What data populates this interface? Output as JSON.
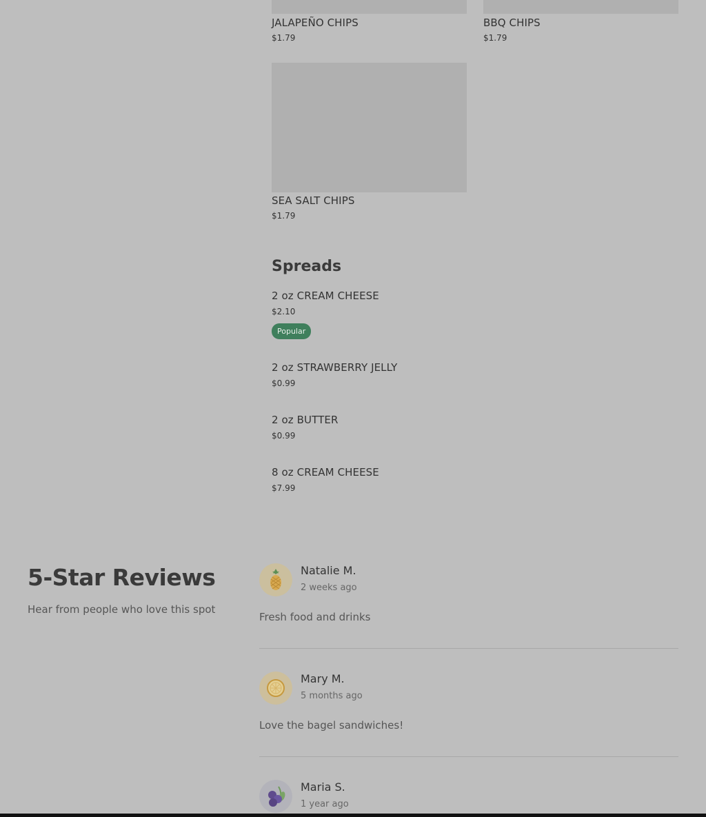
{
  "menu": {
    "chips_items": [
      {
        "name": "JALAPEÑO CHIPS",
        "price": "$1.79"
      },
      {
        "name": "BBQ CHIPS",
        "price": "$1.79"
      },
      {
        "name": "SEA SALT CHIPS",
        "price": "$1.79"
      }
    ],
    "spreads": {
      "title": "Spreads",
      "items": [
        {
          "name": "2 oz CREAM CHEESE",
          "price": "$2.10",
          "badge": "Popular"
        },
        {
          "name": "2 oz STRAWBERRY JELLY",
          "price": "$0.99"
        },
        {
          "name": "2 oz BUTTER",
          "price": "$0.99"
        },
        {
          "name": "8 oz CREAM CHEESE",
          "price": "$7.99"
        }
      ]
    }
  },
  "reviews": {
    "title": "5-Star Reviews",
    "subtitle": "Hear from people who love this spot",
    "items": [
      {
        "name": "Natalie M.",
        "time": "2 weeks ago",
        "text": "Fresh food and drinks",
        "avatar_icon": "pineapple-icon"
      },
      {
        "name": "Mary M.",
        "time": "5 months ago",
        "text": "Love the bagel sandwiches!",
        "avatar_icon": "lemon-slice-icon"
      },
      {
        "name": "Maria S.",
        "time": "1 year ago",
        "text": "",
        "avatar_icon": "blueberries-icon"
      }
    ]
  },
  "colors": {
    "background": "#bebebe",
    "badge_green": "#3f7f5c",
    "text_dark": "#333333"
  }
}
